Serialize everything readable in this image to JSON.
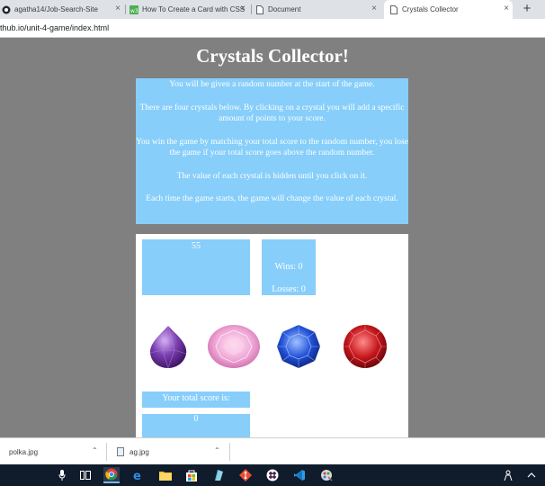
{
  "browser": {
    "tabs": [
      {
        "title": "agatha14/Job-Search-Site",
        "icon": "github-icon"
      },
      {
        "title": "How To Create a Card with CSS",
        "icon": "w3schools-icon"
      },
      {
        "title": "Document",
        "icon": "document-icon"
      },
      {
        "title": "Crystals Collector",
        "icon": "document-icon",
        "active": true
      }
    ],
    "new_tab": "+",
    "close_glyph": "×",
    "url": "thub.io/unit-4-game/index.html"
  },
  "page": {
    "title": "Crystals Collector!",
    "instructions": [
      "You will be given a random number at the start of the game.",
      "There are four crystals below. By clicking on a crystal you will add a specific amount of points to your score.",
      "You win the game by matching your total score to the random number, you lose the game if your total score goes above the random number.",
      "The value of each crystal is hidden until you click on it.",
      "Each time the game starts, the game will change the value of each crystal."
    ],
    "random_number": "55",
    "wins_label": "Wins: 0",
    "losses_label": "Losses: 0",
    "score_label": "Your total score is:",
    "total_score": "0",
    "crystals": [
      {
        "name": "purple-crystal",
        "color": "#7b3fb0"
      },
      {
        "name": "pink-crystal",
        "color": "#f0a6d6"
      },
      {
        "name": "blue-crystal",
        "color": "#1f4fd8"
      },
      {
        "name": "red-crystal",
        "color": "#c4161c"
      }
    ],
    "accent_color": "#87cefa"
  },
  "downloads": [
    {
      "file": "polka.jpg"
    },
    {
      "file": "ag.jpg"
    }
  ],
  "taskbar": {
    "icons": [
      "microphone-icon",
      "task-view-icon",
      "chrome-icon",
      "edge-icon",
      "file-explorer-icon",
      "store-icon",
      "app-icon",
      "git-icon",
      "slack-icon",
      "vscode-icon",
      "paint-icon"
    ]
  }
}
